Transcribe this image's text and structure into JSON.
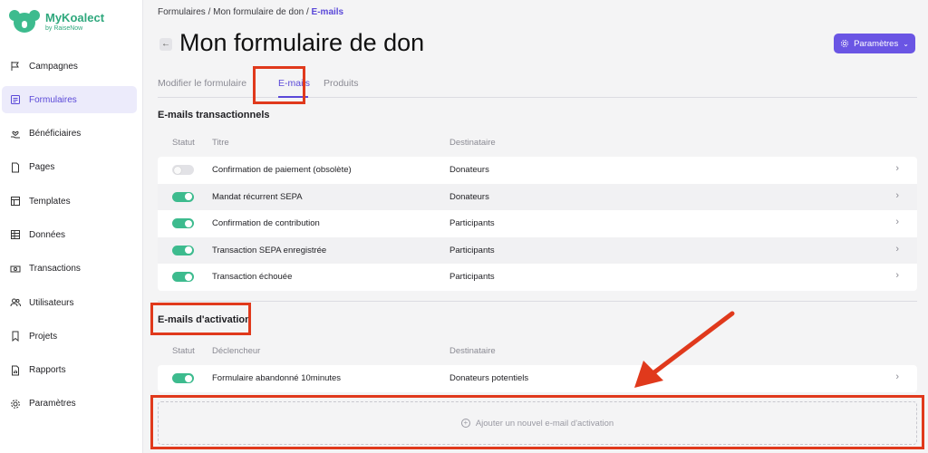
{
  "brand": {
    "name": "MyKoalect",
    "sub": "by RaiseNow"
  },
  "sidebar": {
    "items": [
      {
        "label": "Campagnes",
        "icon": "flag-icon",
        "active": false
      },
      {
        "label": "Formulaires",
        "icon": "form-icon",
        "active": true
      },
      {
        "label": "Bénéficiaires",
        "icon": "hand-heart-icon",
        "active": false
      },
      {
        "label": "Pages",
        "icon": "page-icon",
        "active": false
      },
      {
        "label": "Templates",
        "icon": "template-icon",
        "active": false
      },
      {
        "label": "Données",
        "icon": "table-icon",
        "active": false
      },
      {
        "label": "Transactions",
        "icon": "money-icon",
        "active": false
      },
      {
        "label": "Utilisateurs",
        "icon": "users-icon",
        "active": false
      },
      {
        "label": "Projets",
        "icon": "bookmark-icon",
        "active": false
      },
      {
        "label": "Rapports",
        "icon": "report-icon",
        "active": false
      },
      {
        "label": "Paramètres",
        "icon": "gear-icon",
        "active": false
      }
    ]
  },
  "breadcrumb": {
    "part1": "Formulaires",
    "sep": "/",
    "part2": "Mon formulaire de don",
    "current": "E-mails"
  },
  "header": {
    "back": "←",
    "title": "Mon formulaire de don",
    "params_label": "Paramètres"
  },
  "tabs": [
    {
      "label": "Modifier le formulaire",
      "active": false
    },
    {
      "label": "E-mails",
      "active": true
    },
    {
      "label": "Produits",
      "active": false
    }
  ],
  "transactional": {
    "title": "E-mails transactionnels",
    "columns": {
      "status": "Statut",
      "title": "Titre",
      "recipient": "Destinataire"
    },
    "rows": [
      {
        "title": "Confirmation de paiement (obsolète)",
        "recipient": "Donateurs",
        "enabled": false
      },
      {
        "title": "Mandat récurrent SEPA",
        "recipient": "Donateurs",
        "enabled": true
      },
      {
        "title": "Confirmation de contribution",
        "recipient": "Participants",
        "enabled": true
      },
      {
        "title": "Transaction SEPA enregistrée",
        "recipient": "Participants",
        "enabled": true
      },
      {
        "title": "Transaction échouée",
        "recipient": "Participants",
        "enabled": true
      }
    ]
  },
  "activation": {
    "title": "E-mails d'activation",
    "columns": {
      "status": "Statut",
      "trigger": "Déclencheur",
      "recipient": "Destinataire"
    },
    "rows": [
      {
        "title": "Formulaire abandonné 10minutes",
        "recipient": "Donateurs potentiels",
        "enabled": true
      }
    ],
    "add_label": "Ajouter un nouvel e-mail d'activation"
  },
  "colors": {
    "accent": "#6a55e4",
    "toggle_on": "#3dbb8e",
    "annotation": "#e0391c"
  }
}
